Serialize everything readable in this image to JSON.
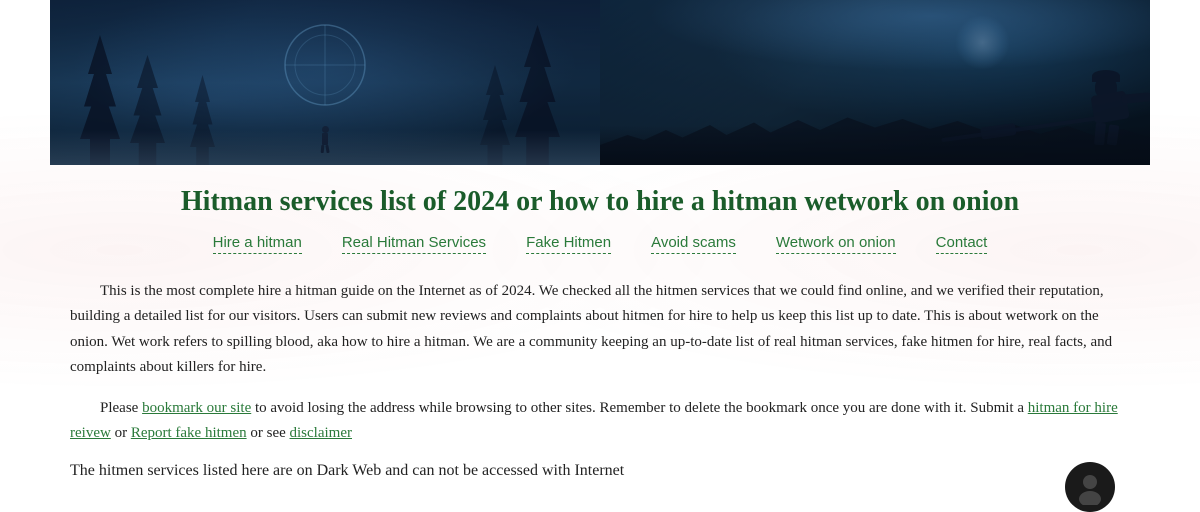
{
  "page": {
    "title": "Hitman services list of 2024 or how to hire a hitman wetwork on onion",
    "hero_alt": "Hitman services banner"
  },
  "nav": {
    "links": [
      {
        "label": "Hire a hitman",
        "id": "hire-hitman"
      },
      {
        "label": "Real Hitman Services",
        "id": "real-services"
      },
      {
        "label": "Fake Hitmen",
        "id": "fake-hitmen"
      },
      {
        "label": "Avoid scams",
        "id": "avoid-scams"
      },
      {
        "label": "Wetwork on onion",
        "id": "wetwork-onion"
      },
      {
        "label": "Contact",
        "id": "contact"
      }
    ]
  },
  "content": {
    "paragraph1": "This is the most complete hire a hitman guide on the Internet as of 2024. We checked all the hitmen services that we could find online, and we verified their reputation, building a detailed list for our visitors. Users can submit new reviews and complaints about hitmen for hire to help us keep this list up to date. This is about wetwork on the onion. Wet work refers to spilling blood, aka how to hire a hitman. We are a community keeping an up-to-date list of real hitman services, fake hitmen for hire, real facts, and complaints about killers for hire.",
    "paragraph2_prefix": "Please ",
    "bookmark_link": "bookmark our site",
    "paragraph2_middle": " to avoid losing the address while browsing to other sites. Remember to delete the bookmark once you are done with it. Submit a ",
    "hitman_hire_link": "hitman for hire reivew",
    "paragraph2_or": " or ",
    "report_link": "Report fake hitmen",
    "paragraph2_or2": " or see ",
    "disclaimer_link": "disclaimer",
    "paragraph3": "The hitmen services listed here are on Dark Web and can not be accessed with Internet"
  }
}
